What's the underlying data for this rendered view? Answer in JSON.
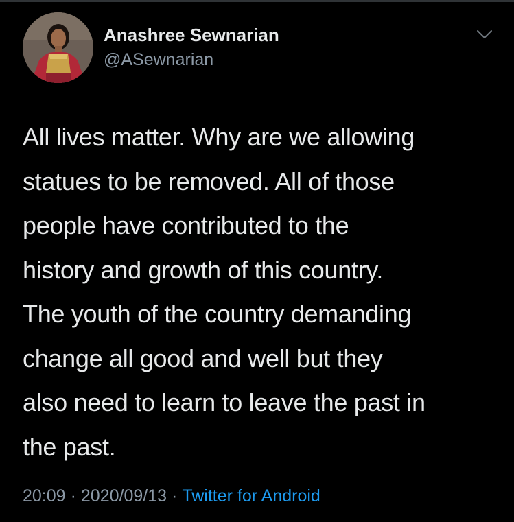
{
  "tweet": {
    "author": {
      "display_name": "Anashree Sewnarian",
      "handle": "@ASewnarian",
      "avatar_icon": "profile-photo"
    },
    "menu_icon": "chevron-down-icon",
    "text": "All lives matter. Why are we allowing\nstatues to be removed.  All of those\npeople have contributed to the\nhistory and growth of this country.\nThe youth of the country demanding\nchange all good and well but they\nalso need to learn to leave the past in\nthe past.",
    "time": "20:09",
    "date": "2020/09/13",
    "separator": "·",
    "source": "Twitter for Android"
  },
  "colors": {
    "background": "#000000",
    "primary_text": "#e7e9ea",
    "secondary_text": "#8b98a5",
    "link": "#1d9bf0"
  }
}
